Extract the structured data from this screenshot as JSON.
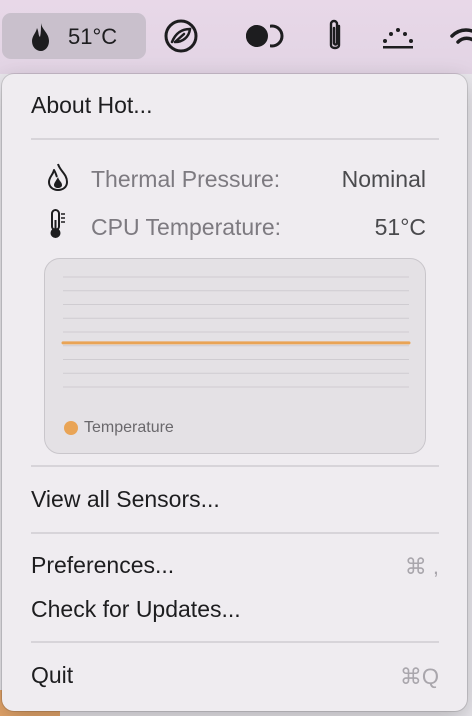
{
  "menubar": {
    "temperature": "51°C",
    "icons": [
      "flame-icon",
      "leaf-circle-icon",
      "dual-circle-icon",
      "paperclip-icon",
      "dots-arc-icon",
      "wifi-icon"
    ]
  },
  "menu": {
    "about": "About Hot...",
    "thermal_label": "Thermal Pressure:",
    "thermal_value": "Nominal",
    "cpu_label": "CPU Temperature:",
    "cpu_value": "51°C",
    "view_sensors": "View all Sensors...",
    "preferences": "Preferences...",
    "preferences_shortcut": "⌘ ,",
    "check_updates": "Check for Updates...",
    "quit": "Quit",
    "quit_shortcut": "⌘Q"
  },
  "colors": {
    "accent": "#e9a456"
  },
  "chart_data": {
    "type": "line",
    "series": [
      {
        "name": "Temperature",
        "values": [
          51,
          51,
          51,
          51,
          51,
          51,
          51,
          51,
          51,
          51
        ]
      }
    ],
    "xlabel": "",
    "ylabel": "",
    "grid": true,
    "legend": "bottom-left"
  }
}
